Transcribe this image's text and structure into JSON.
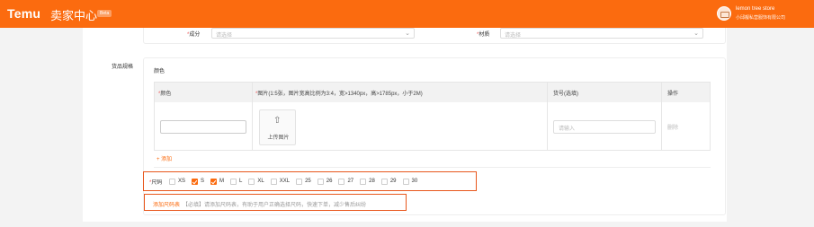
{
  "header": {
    "logo": "Temu",
    "title": "卖家中心",
    "badge": "Beta",
    "store_name": "lemon tree store",
    "store_company": "小邱靓私营服饰有限公司"
  },
  "attributes": {
    "field1_label": "成分",
    "field1_placeholder": "请选择",
    "field2_label": "材质",
    "field2_placeholder": "请选择"
  },
  "spec": {
    "section_label": "货品规格",
    "color_title": "颜色",
    "columns": [
      "*颜色",
      "*图片(1:5张，图片宽高比例为3:4，宽>1340px，高>1785px，小于2M)",
      "货号(选填)",
      "操作"
    ],
    "upload_label": "上传图片",
    "sku_placeholder": "请输入",
    "delete_label": "删除",
    "add_label": "+ 添加"
  },
  "size": {
    "label": "*尺码",
    "options": [
      {
        "label": "XS",
        "checked": false
      },
      {
        "label": "S",
        "checked": true
      },
      {
        "label": "M",
        "checked": true
      },
      {
        "label": "L",
        "checked": false
      },
      {
        "label": "XL",
        "checked": false
      },
      {
        "label": "XXL",
        "checked": false
      },
      {
        "label": "25",
        "checked": false
      },
      {
        "label": "26",
        "checked": false
      },
      {
        "label": "27",
        "checked": false
      },
      {
        "label": "28",
        "checked": false
      },
      {
        "label": "29",
        "checked": false
      },
      {
        "label": "30",
        "checked": false
      }
    ]
  },
  "size_chart": {
    "link": "添加尺码表",
    "hint": "【必填】请添加尺码表，有助于用户正确选择尺码，快速下单，减少售后纠纷"
  }
}
